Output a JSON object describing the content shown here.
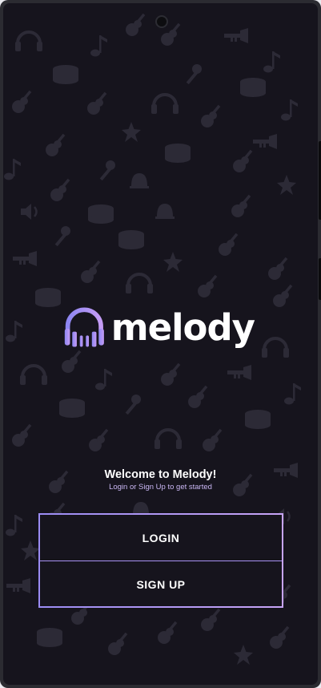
{
  "app": {
    "name": "melody",
    "welcome_title": "Welcome to Melody!",
    "welcome_subtitle": "Login or Sign Up to get started"
  },
  "auth": {
    "login_label": "LOGIN",
    "signup_label": "SIGN UP"
  },
  "background": {
    "pattern_icons": [
      "headphones-icon",
      "guitar-icon",
      "drum-icon",
      "trumpet-icon",
      "music-note-icon",
      "microphone-icon",
      "bell-icon",
      "speaker-icon",
      "violin-icon",
      "star-icon",
      "maracas-icon"
    ]
  },
  "colors": {
    "background": "#16141d",
    "pattern": "#2c2a36",
    "accent_start": "#9b8cf4",
    "accent_end": "#c7a4f6",
    "subtitle": "#c9b6f3"
  }
}
